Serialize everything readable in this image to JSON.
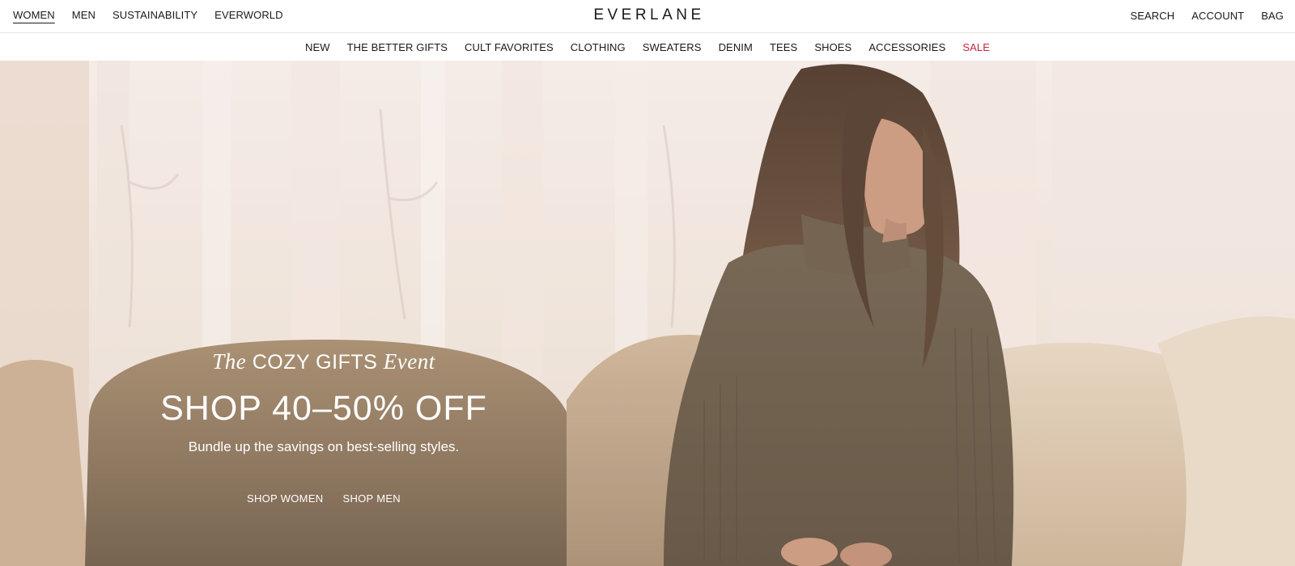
{
  "topbar": {
    "left_links": [
      {
        "label": "WOMEN",
        "active": true
      },
      {
        "label": "MEN",
        "active": false
      },
      {
        "label": "SUSTAINABILITY",
        "active": false
      },
      {
        "label": "EVERWORLD",
        "active": false
      }
    ],
    "logo": "EVERLANE",
    "right_links": [
      "SEARCH",
      "ACCOUNT",
      "BAG"
    ]
  },
  "category_nav": [
    "NEW",
    "THE BETTER GIFTS",
    "CULT FAVORITES",
    "CLOTHING",
    "SWEATERS",
    "DENIM",
    "TEES",
    "SHOES",
    "ACCESSORIES",
    "SALE"
  ],
  "hero": {
    "eyebrow_pre": "The",
    "eyebrow_main": "COZY GIFTS",
    "eyebrow_post": "Event",
    "headline": "SHOP 40–50% OFF",
    "subhead": "Bundle up the savings on best-selling styles.",
    "cta_women": "SHOP WOMEN",
    "cta_men": "SHOP MEN"
  },
  "colors": {
    "sale": "#c2273f",
    "text": "#1a1a1a",
    "hero_text": "#ffffff"
  }
}
